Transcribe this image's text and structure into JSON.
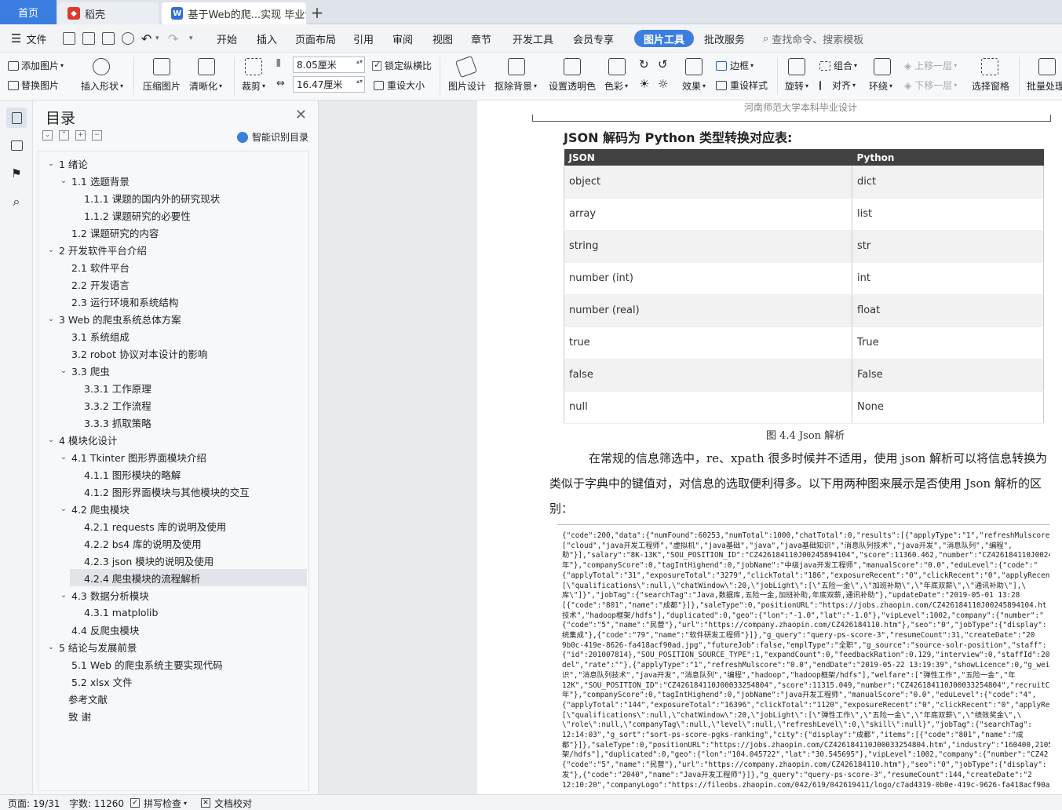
{
  "tabs": {
    "home": "首页",
    "wps": "稻壳",
    "doc": "基于Web的爬...实现 毕业论文",
    "add": "+"
  },
  "menu": {
    "file": "文件",
    "items": [
      "开始",
      "插入",
      "页面布局",
      "引用",
      "审阅",
      "视图",
      "章节",
      "开发工具",
      "会员专享"
    ],
    "active": "图片工具",
    "after": "批改服务",
    "search": "查找命令、搜索模板"
  },
  "ribbon": {
    "add_image": "添加图片",
    "replace_image": "替换图片",
    "insert_shape": "插入形状",
    "compress": "压缩图片",
    "sharpen": "清晰化",
    "crop": "裁剪",
    "width": "8.05厘米",
    "height": "16.47厘米",
    "lock_ratio": "锁定纵横比",
    "reset_size": "重设大小",
    "image_design": "图片设计",
    "remove_bg": "抠除背景",
    "set_transparent": "设置透明色",
    "color": "色彩",
    "effects": "效果",
    "border": "边框",
    "reset_style": "重设样式",
    "rotate": "旋转",
    "group": "组合",
    "align": "对齐",
    "wrap": "环绕",
    "bring_forward": "上移一层",
    "send_backward": "下移一层",
    "selection_pane": "选择窗格",
    "batch": "批量处理"
  },
  "toc": {
    "title": "目录",
    "ai_label": "智能识别目录",
    "items": [
      {
        "text": "1  绪论",
        "level": 0,
        "caret": "v"
      },
      {
        "text": "1.1   选题背景",
        "level": 1,
        "caret": "v"
      },
      {
        "text": "1.1.1  课题的国内外的研究现状",
        "level": 2,
        "caret": ""
      },
      {
        "text": "1.1.2  课题研究的必要性",
        "level": 2,
        "caret": ""
      },
      {
        "text": "1.2   课题研究的内容",
        "level": 1,
        "caret": ""
      },
      {
        "text": "2  开发软件平台介绍",
        "level": 0,
        "caret": "v"
      },
      {
        "text": "2.1  软件平台",
        "level": 1,
        "caret": ""
      },
      {
        "text": "2.2  开发语言",
        "level": 1,
        "caret": ""
      },
      {
        "text": "2.3  运行环境和系统结构",
        "level": 1,
        "caret": ""
      },
      {
        "text": "3  Web 的爬虫系统总体方案",
        "level": 0,
        "caret": "v"
      },
      {
        "text": "3.1   系统组成",
        "level": 1,
        "caret": ""
      },
      {
        "text": "3.2   robot 协议对本设计的影响",
        "level": 1,
        "caret": ""
      },
      {
        "text": "3.3   爬虫",
        "level": 1,
        "caret": "v"
      },
      {
        "text": "3.3.1  工作原理",
        "level": 2,
        "caret": ""
      },
      {
        "text": "3.3.2  工作流程",
        "level": 2,
        "caret": ""
      },
      {
        "text": "3.3.3  抓取策略",
        "level": 2,
        "caret": ""
      },
      {
        "text": "4  模块化设计",
        "level": 0,
        "caret": "v"
      },
      {
        "text": "4.1  Tkinter 图形界面模块介绍",
        "level": 1,
        "caret": "v"
      },
      {
        "text": "4.1.1  图形模块的略解",
        "level": 2,
        "caret": ""
      },
      {
        "text": "4.1.2  图形界面模块与其他模块的交互",
        "level": 2,
        "caret": ""
      },
      {
        "text": "4.2   爬虫模块",
        "level": 1,
        "caret": "v"
      },
      {
        "text": "4.2.1  requests 库的说明及使用",
        "level": 2,
        "caret": ""
      },
      {
        "text": "4.2.2  bs4 库的说明及使用",
        "level": 2,
        "caret": ""
      },
      {
        "text": "4.2.3  json 模块的说明及使用",
        "level": 2,
        "caret": ""
      },
      {
        "text": "4.2.4  爬虫模块的流程解析",
        "level": 2,
        "caret": "",
        "selected": true
      },
      {
        "text": "4.3 数据分析模块",
        "level": 1,
        "caret": "v"
      },
      {
        "text": "4.3.1  matplolib",
        "level": 2,
        "caret": ""
      },
      {
        "text": "4.4   反爬虫模块",
        "level": 1,
        "caret": ""
      },
      {
        "text": "5  结论与发展前景",
        "level": 0,
        "caret": "v"
      },
      {
        "text": "5.1  Web 的爬虫系统主要实现代码",
        "level": 1,
        "caret": ""
      },
      {
        "text": "5.2  xlsx 文件",
        "level": 1,
        "caret": ""
      },
      {
        "text": "参考文献",
        "level": -1,
        "caret": ""
      },
      {
        "text": "致   谢",
        "level": -1,
        "caret": ""
      }
    ]
  },
  "doc": {
    "header": "河南师范大学本科毕业设计",
    "heading": "JSON 解码为 Python 类型转换对应表:",
    "table_headers": [
      "JSON",
      "Python"
    ],
    "table_rows": [
      [
        "object",
        "dict"
      ],
      [
        "array",
        "list"
      ],
      [
        "string",
        "str"
      ],
      [
        "number (int)",
        "int"
      ],
      [
        "number (real)",
        "float"
      ],
      [
        "true",
        "True"
      ],
      [
        "false",
        "False"
      ],
      [
        "null",
        "None"
      ]
    ],
    "caption": "图 4.4 Json 解析",
    "paragraph": "在常规的信息筛选中，re、xpath 很多时候并不适用，使用 json 解析可以将信息转换为类似于字典中的键值对，对信息的选取便利得多。以下用两种图来展示是否使用 Json 解析的区别：",
    "code_lines": [
      "{\"code\":200,\"data\":{\"numFound\":60253,\"numTotal\":1000,\"chatTotal\":0,\"results\":[{\"applyType\":\"1\",\"refreshMulscore\"",
      "[\"cloud\",\"java开发工程师\",\"虚拟机\",\"java基础\",\"java\",\"java基础知识\",\"消息队列技术\",\"java开发\",\"消息队列\",\"编程\",",
      "助\"}],\"salary\":\"8K-13K\",\"SOU_POSITION_ID\":\"CZ426184110J00245894104\",\"score\":11360.462,\"number\":\"CZ426184110J0024",
      "年\"},\"companyScore\":0,\"tagIntHighend\":0,\"jobName\":\"中级java开发工程师\",\"manualScore\":\"0.0\",\"eduLevel\":{\"code\":\"",
      "{\"applyTotal\":\"31\",\"exposureTotal\":\"3279\",\"clickTotal\":\"186\",\"exposureRecent\":\"0\",\"clickRecent\":\"0\",\"applyRecen",
      "[\\\"qualifications\\\":null,\\\"chatWindow\\\":20,\\\"jobLight\\\":[\\\"五险一金\\\",\\\"加班补助\\\",\\\"年底双薪\\\",\\\"通讯补助\\\"],\\",
      "库\\\"]}\",\"jobTag\":{\"searchTag\":\"Java,数据库,五险一金,加班补助,年底双薪,通讯补助\"},\"updateDate\":\"2019-05-01 13:28",
      "[{\"code\":\"801\",\"name\":\"成都\"}]},\"saleType\":0,\"positionURL\":\"https://jobs.zhaopin.com/CZ426184110J00245894104.ht",
      "技术\",\"hadoop框架/hdfs\"],\"duplicated\":0,\"geo\":{\"lon\":\"-1.0\",\"lat\":\"-1.0\"},\"vipLevel\":1002,\"company\":{\"number\":\"",
      "{\"code\":\"5\",\"name\":\"民营\"},\"url\":\"https://company.zhaopin.com/CZ426184110.htm\"},\"seo\":\"0\",\"jobType\":{\"display\":",
      "统集成\"},{\"code\":\"79\",\"name\":\"软件研发工程师\"}]},\"g_query\":\"query-ps-score-3\",\"resumeCount\":31,\"createDate\":\"20",
      "9b0c-419e-8626-fa418acf90ad.jpg\",\"futureJob\":false,\"emplType\":\"全职\",\"g_source\":\"source-solr-position\",\"staff\":",
      "{\"id\":201007814},\"SOU_POSITION_SOURCE_TYPE\":1,\"expandCount\":0,\"feedbackRation\":0.129,\"interview\":0,\"staffId\":20",
      "del\",\"rate\":\"\"},{\"applyType\":\"1\",\"refreshMulscore\":\"0.0\",\"endDate\":\"2019-05-22 13:19:39\",\"showLicence\":0,\"g_weig",
      "识\",\"消息队列技术\",\"java开发\",\"消息队列\",\"编程\",\"hadoop\",\"hadoop框架/hdfs\"],\"welfare\":[\"弹性工作\",\"五险一金\",\"年",
      "12K\",\"SOU_POSITION_ID\":\"CZ426184110J00033254804\",\"score\":11315.049,\"number\":\"CZ426184110J00033254804\",\"recruitCo",
      "年\"},\"companyScore\":0,\"tagIntHighend\":0,\"jobName\":\"java开发工程师\",\"manualScore\":\"0.0\",\"eduLevel\":{\"code\":\"4\",",
      "{\"applyTotal\":\"144\",\"exposureTotal\":\"16396\",\"clickTotal\":\"1120\",\"exposureRecent\":\"0\",\"clickRecent\":\"0\",\"applyRe",
      "[\\\"qualifications\\\":null,\\\"chatWindow\\\":20,\\\"jobLight\\\":[\\\"弹性工作\\\",\\\"五险一金\\\",\\\"年底双薪\\\",\\\"绩效奖金\\\",\\",
      "\\\"role\\\":null,\\\"companyTag\\\":null,\\\"level\\\":null,\\\"refreshLevel\\\":0,\\\"skill\\\":null}\",\"jobTag\":{\"searchTag\":",
      "12:14:03\",\"g_sort\":\"sort-ps-score-pgks-ranking\",\"city\":{\"display\":\"成都\",\"items\":[{\"code\":\"801\",\"name\":\"成",
      "都\"}]},\"saleType\":0,\"positionURL\":\"https://jobs.zhaopin.com/CZ426184110J00033254804.htm\",\"industry\":\"160400,2105",
      "架/hdfs\"],\"duplicated\":0,\"geo\":{\"lon\":\"104.045722\",\"lat\":\"30.545695\"},\"vipLevel\":1002,\"company\":{\"number\":\"CZ42",
      "{\"code\":\"5\",\"name\":\"民营\"},\"url\":\"https://company.zhaopin.com/CZ426184110.htm\"},\"seo\":\"0\",\"jobType\":{\"display\":",
      "发\"},{\"code\":\"2040\",\"name\":\"Java开发工程师\"}]},\"g_query\":\"query-ps-score-3\",\"resumeCount\":144,\"createDate\":\"2",
      "12:10:20\",\"companyLogo\":\"https://fileobs.zhaopin.com/042/619/042619411/logo/c7ad4319-0b0e-419c-9626-fa418acf90a"
    ]
  },
  "status": {
    "page": "页面: 19/31",
    "words": "字数: 11260",
    "spell": "拼写检查",
    "proof": "文档校对"
  },
  "colors": {
    "accent": "#3c7de0",
    "table_header": "#414141"
  }
}
